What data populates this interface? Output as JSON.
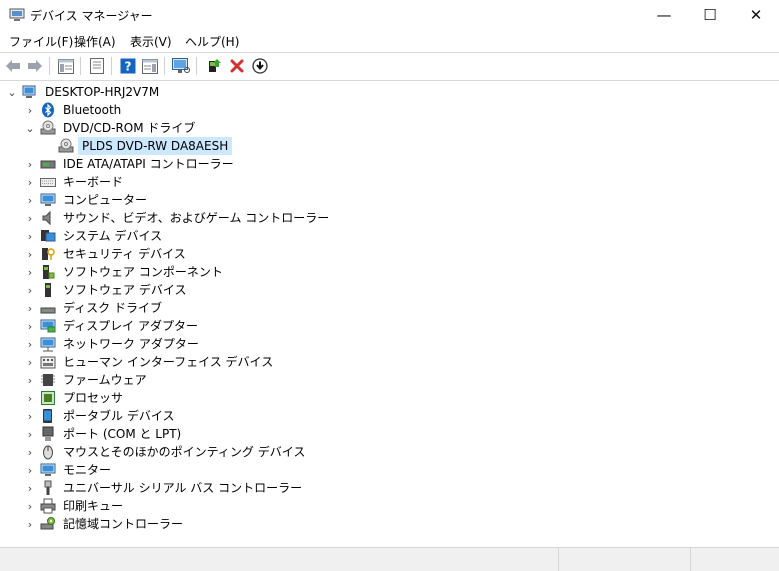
{
  "window": {
    "title": "デバイス マネージャー",
    "controls": {
      "minimize": "—",
      "maximize": "☐",
      "close": "✕"
    }
  },
  "menu": [
    {
      "label": "ファイル(F)"
    },
    {
      "label": "操作(A)"
    },
    {
      "label": "表示(V)"
    },
    {
      "label": "ヘルプ(H)"
    }
  ],
  "tree": {
    "root": "DESKTOP-HRJ2V7M",
    "categories": [
      {
        "label": "Bluetooth",
        "icon": "bluetooth-icon"
      },
      {
        "label": "DVD/CD-ROM ドライブ",
        "icon": "dvd-drive-icon"
      },
      {
        "label": "PLDS DVD-RW DA8AESH",
        "icon": "dvd-drive-icon"
      },
      {
        "label": "IDE ATA/ATAPI コントローラー",
        "icon": "ide-controller-icon"
      },
      {
        "label": "キーボード",
        "icon": "keyboard-icon"
      },
      {
        "label": "コンピューター",
        "icon": "computer-icon"
      },
      {
        "label": "サウンド、ビデオ、およびゲーム コントローラー",
        "icon": "speaker-icon"
      },
      {
        "label": "システム デバイス",
        "icon": "system-device-icon"
      },
      {
        "label": "セキュリティ デバイス",
        "icon": "security-device-icon"
      },
      {
        "label": "ソフトウェア コンポーネント",
        "icon": "software-component-icon"
      },
      {
        "label": "ソフトウェア デバイス",
        "icon": "software-device-icon"
      },
      {
        "label": "ディスク ドライブ",
        "icon": "disk-drive-icon"
      },
      {
        "label": "ディスプレイ アダプター",
        "icon": "display-adapter-icon"
      },
      {
        "label": "ネットワーク アダプター",
        "icon": "network-adapter-icon"
      },
      {
        "label": "ヒューマン インターフェイス デバイス",
        "icon": "hid-icon"
      },
      {
        "label": "ファームウェア",
        "icon": "firmware-icon"
      },
      {
        "label": "プロセッサ",
        "icon": "processor-icon"
      },
      {
        "label": "ポータブル デバイス",
        "icon": "portable-device-icon"
      },
      {
        "label": "ポート (COM と LPT)",
        "icon": "port-icon"
      },
      {
        "label": "マウスとそのほかのポインティング デバイス",
        "icon": "mouse-icon"
      },
      {
        "label": "モニター",
        "icon": "monitor-icon"
      },
      {
        "label": "ユニバーサル シリアル バス コントローラー",
        "icon": "usb-icon"
      },
      {
        "label": "印刷キュー",
        "icon": "printer-icon"
      },
      {
        "label": "記憶域コントローラー",
        "icon": "storage-controller-icon"
      }
    ]
  },
  "colors": {
    "selection": "#cce8ff",
    "help": "#1565c0",
    "delete": "#d32f2f"
  }
}
